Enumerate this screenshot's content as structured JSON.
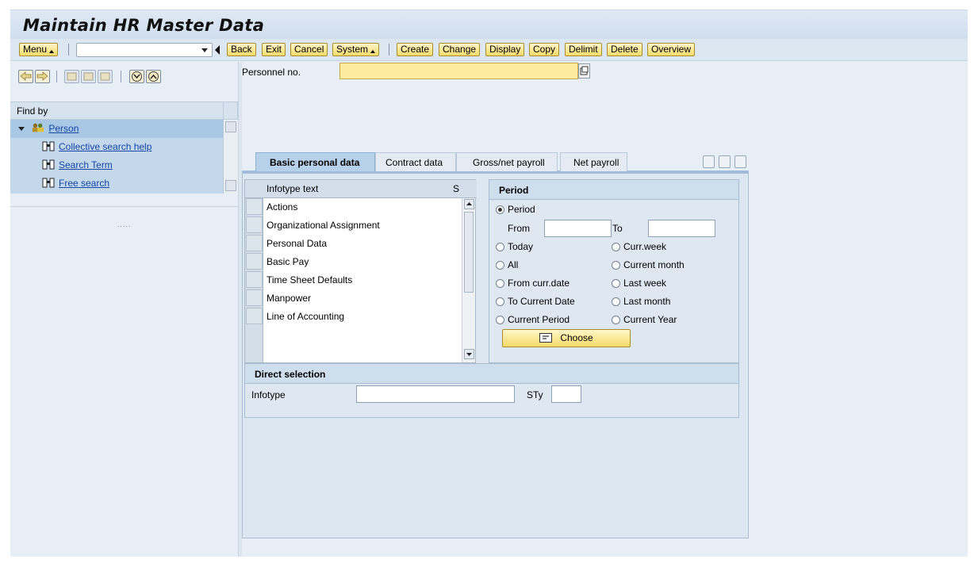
{
  "title": "Maintain HR Master Data",
  "toolbar": {
    "menu": "Menu",
    "buttons": [
      "Back",
      "Exit",
      "Cancel",
      "System",
      "Create",
      "Change",
      "Display",
      "Copy",
      "Delimit",
      "Delete",
      "Overview"
    ]
  },
  "left": {
    "find_by": "Find by",
    "tree_root": "Person",
    "tree_items": [
      "Collective search help",
      "Search Term",
      "Free search"
    ],
    "dots": "....."
  },
  "personnel_label": "Personnel no.",
  "personnel_value": "",
  "tabs": [
    "Basic personal data",
    "Contract data",
    "Gross/net payroll",
    "Net payroll"
  ],
  "grid": {
    "col1": "Infotype text",
    "col2": "S",
    "rows": [
      "Actions",
      "Organizational Assignment",
      "Personal Data",
      "Basic Pay",
      "Time Sheet Defaults",
      "Manpower",
      "Line of Accounting"
    ]
  },
  "period": {
    "header": "Period",
    "radio_period": "Period",
    "from": "From",
    "to": "To",
    "options_left": [
      "Today",
      "All",
      "From curr.date",
      "To Current Date",
      "Current Period"
    ],
    "options_right": [
      "Curr.week",
      "Current month",
      "Last week",
      "Last month",
      "Current Year"
    ],
    "selected": "Period",
    "choose": "Choose"
  },
  "direct": {
    "header": "Direct selection",
    "infotype": "Infotype",
    "sty": "STy"
  }
}
